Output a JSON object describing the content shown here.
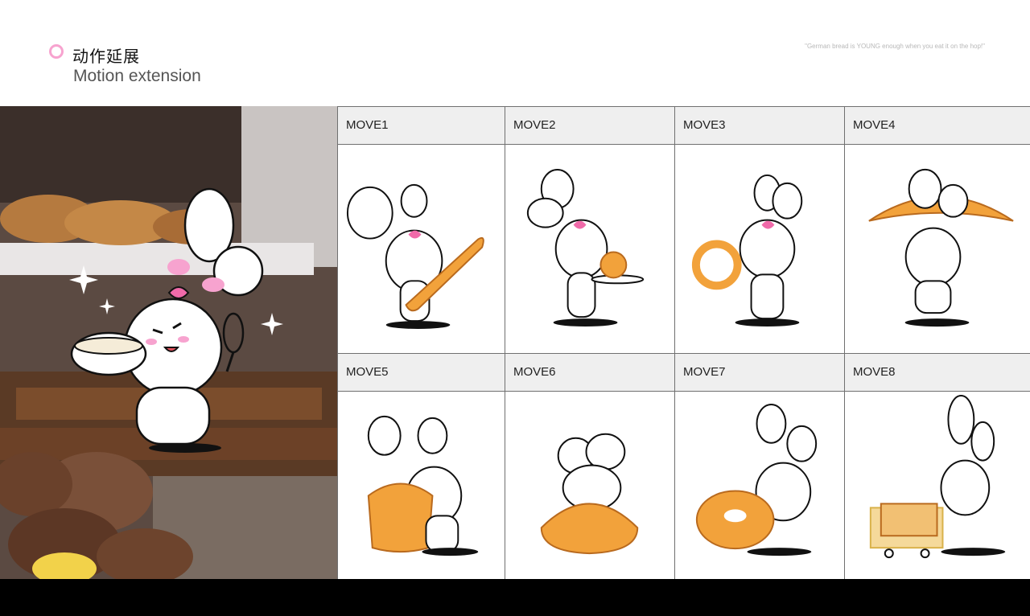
{
  "header": {
    "title_cn": "动作延展",
    "title_en": "Motion extension",
    "quote": "\"German bread is YOUNG enough when you eat it on the hop!\""
  },
  "moves": [
    {
      "label": "MOVE1",
      "prop": "baguette"
    },
    {
      "label": "MOVE2",
      "prop": "pastry-plate"
    },
    {
      "label": "MOVE3",
      "prop": "pretzel"
    },
    {
      "label": "MOVE4",
      "prop": "croissant"
    },
    {
      "label": "MOVE5",
      "prop": "bundt-cake"
    },
    {
      "label": "MOVE6",
      "prop": "melon-bun"
    },
    {
      "label": "MOVE7",
      "prop": "bagel"
    },
    {
      "label": "MOVE8",
      "prop": "bread-cart"
    }
  ],
  "colors": {
    "accent_pink": "#f7a3cf",
    "bread_orange": "#f2a23b",
    "bottom_bar": "#000000",
    "header_cell": "#efefef"
  }
}
